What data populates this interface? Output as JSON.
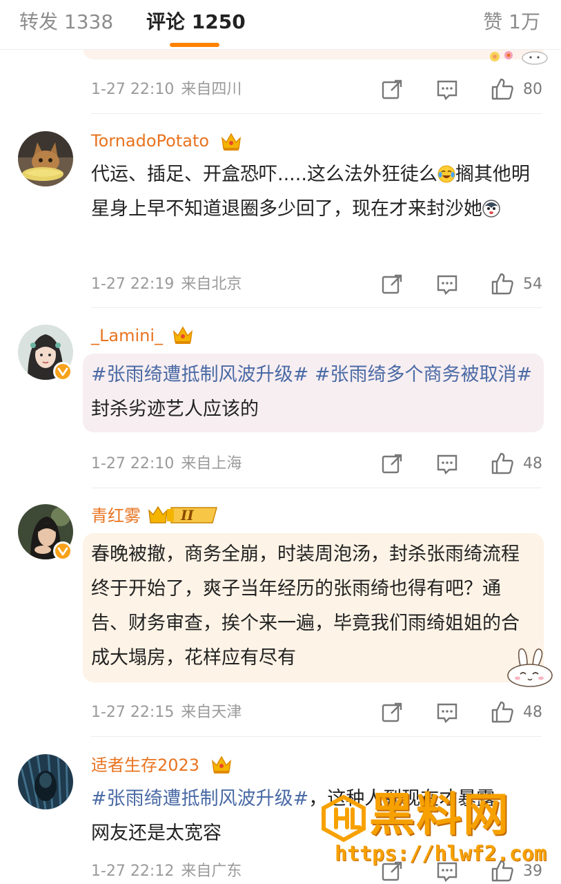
{
  "tabs": {
    "reposts": "转发 1338",
    "comments": "评论 1250",
    "likes": "赞 1万"
  },
  "comments": [
    {
      "time": "1-27 22:10",
      "location": "来自四川",
      "likes": "80"
    },
    {
      "username": "TornadoPotato",
      "text_a": "代运、插足、开盒恐吓.....这么法外狂徒么",
      "text_b": "搁其他明星身上早不知道退圈多少回了，现在才来封沙她",
      "time": "1-27 22:19",
      "location": "来自北京",
      "likes": "54"
    },
    {
      "username": "_Lamini_",
      "hashtag_1": "#张雨绮遭抵制风波升级#",
      "hashtag_2": "#张雨绮多个商务被取消#",
      "text": "封杀劣迹艺人应该的",
      "time": "1-27 22:10",
      "location": "来自上海",
      "likes": "48"
    },
    {
      "username": "青红雾",
      "level": "II",
      "text": "春晚被撤，商务全崩，时装周泡汤，封杀张雨绮流程终于开始了，爽子当年经历的张雨绮也得有吧？通告、财务审查，挨个来一遍，毕竟我们雨绮姐姐的合成大塌房，花样应有尽有",
      "time": "1-27 22:15",
      "location": "来自天津",
      "likes": "48"
    },
    {
      "username": "适者生存2023",
      "hashtag_1": "#张雨绮遭抵制风波升级#",
      "text": "，这种人到现在才暴露",
      "text_2": "网友还是太宽容",
      "time": "1-27 22:12",
      "location": "来自广东",
      "likes": "39"
    }
  ],
  "watermark": {
    "title": "黑料网",
    "url": "https://hlwf2.com"
  },
  "colors": {
    "accent": "#ff8200",
    "username": "#e8731f",
    "hashtag": "#4a6aa5",
    "meta": "#9a9a9a"
  },
  "icons": [
    "share-icon",
    "comment-icon",
    "like-icon",
    "crown-icon",
    "verified-icon"
  ]
}
